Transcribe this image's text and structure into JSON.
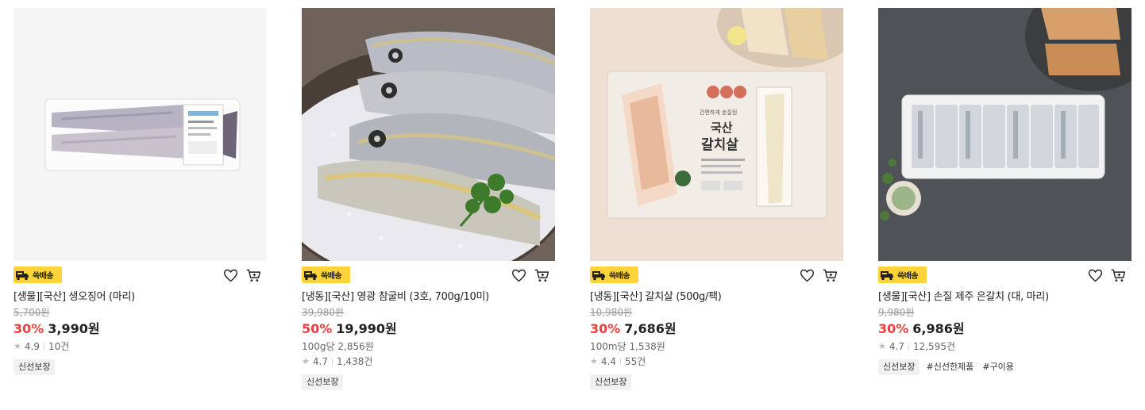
{
  "products": [
    {
      "badge": "쓱배송",
      "name": "[생물][국산] 생오징어 (마리)",
      "original_price": "5,700원",
      "discount": "30%",
      "sale_price": "3,990원",
      "unit_price": null,
      "rating": "4.9",
      "reviews": "10건",
      "tags": [
        "신선보장"
      ],
      "image_subject": "squid-pack"
    },
    {
      "badge": "쓱배송",
      "name": "[냉동][국산] 영광 참굴비 (3호, 700g/10미)",
      "original_price": "39,980원",
      "discount": "50%",
      "sale_price": "19,990원",
      "unit_price": "100g당 2,856원",
      "rating": "4.7",
      "reviews": "1,438건",
      "tags": [
        "신선보장"
      ],
      "image_subject": "yellow-croaker-on-salt"
    },
    {
      "badge": "쓱배송",
      "name": "[냉동][국산] 갈치살 (500g/팩)",
      "original_price": "10,980원",
      "discount": "30%",
      "sale_price": "7,686원",
      "unit_price": "100m당 1,538원",
      "rating": "4.4",
      "reviews": "55건",
      "tags": [
        "신선보장"
      ],
      "image_subject": "hairtail-fillet-pack",
      "package_text": {
        "top": "간편하게 손질된",
        "main1": "국산",
        "main2": "갈치살"
      }
    },
    {
      "badge": "쓱배송",
      "name": "[생물][국산] 손질 제주 은갈치 (대, 마리)",
      "original_price": "9,980원",
      "discount": "30%",
      "sale_price": "6,986원",
      "unit_price": null,
      "rating": "4.7",
      "reviews": "12,595건",
      "tags": [
        "신선보장",
        "#신선한제품",
        "#구이용"
      ],
      "image_subject": "silver-hairtail-tray"
    }
  ],
  "colors": {
    "badge": "#ffd43b",
    "discount": "#f03e3e"
  }
}
